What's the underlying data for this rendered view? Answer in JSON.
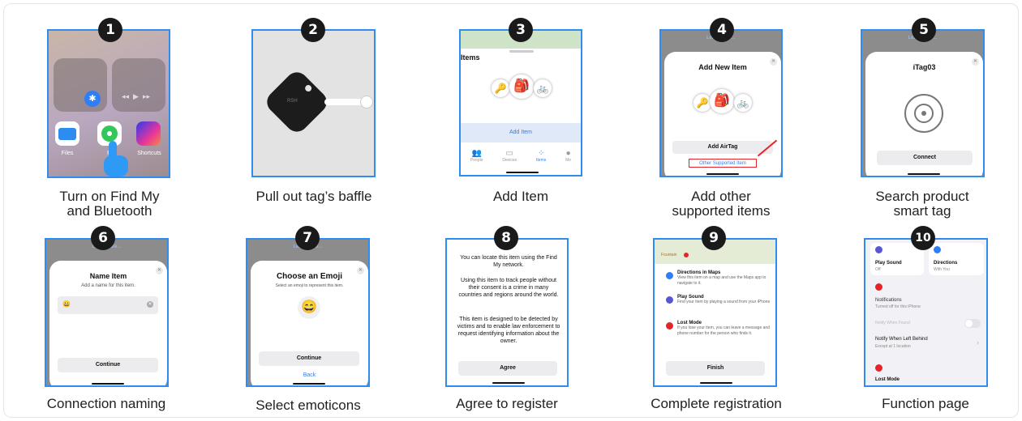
{
  "steps": [
    {
      "num": "1",
      "caption_line1": "Turn on Find My",
      "caption_line2": "and Bluetooth"
    },
    {
      "num": "2",
      "caption_line1": "Pull out tag’s baffle",
      "caption_line2": ""
    },
    {
      "num": "3",
      "caption_line1": "Add Item",
      "caption_line2": ""
    },
    {
      "num": "4",
      "caption_line1": "Add other",
      "caption_line2": "supported items"
    },
    {
      "num": "5",
      "caption_line1": "Search product",
      "caption_line2": "smart tag"
    },
    {
      "num": "6",
      "caption_line1": "Connection naming",
      "caption_line2": ""
    },
    {
      "num": "7",
      "caption_line1": "Select emoticons",
      "caption_line2": ""
    },
    {
      "num": "8",
      "caption_line1": "Agree to register",
      "caption_line2": ""
    },
    {
      "num": "9",
      "caption_line1": "Complete registration",
      "caption_line2": ""
    },
    {
      "num": "10",
      "caption_line1": "Function page",
      "caption_line2": ""
    }
  ],
  "s1": {
    "files": "Files",
    "findmy": "Fi",
    "shortcuts": "Shortcuts"
  },
  "s2": {
    "tag_text": "RSH"
  },
  "s3": {
    "title": "Items",
    "add_item": "Add Item",
    "tabs": [
      "People",
      "Devices",
      "Items",
      "Me"
    ]
  },
  "s4": {
    "learn": "Learn More...",
    "title": "Add New Item",
    "add_airtag": "Add AirTag",
    "other": "Other Supported Item"
  },
  "s5": {
    "learn": "Learn More...",
    "title": "iTag03",
    "connect": "Connect"
  },
  "s6": {
    "learn": "Learn More...",
    "title": "Name Item",
    "subtitle": "Add a name for this item.",
    "emoji": "😀",
    "continue": "Continue"
  },
  "s7": {
    "learn": "Learn More...",
    "title": "Choose an Emoji",
    "subtitle": "Select an emoji to represent this item.",
    "emoji": "😄",
    "continue": "Continue",
    "back": "Back"
  },
  "s8": {
    "p1": "You can locate this item using the Find My network.",
    "p2": "Using this item to track people without their consent is a crime in many countries and regions around the world.",
    "p3": "This item is designed to be detected by victims and to enable law enforcement to request identifying information about the owner.",
    "agree": "Agree"
  },
  "s9": {
    "map_label": "Fountain",
    "items": [
      {
        "title": "Directions in Maps",
        "desc": "View this item on a map and use the Maps app to navigate to it."
      },
      {
        "title": "Play Sound",
        "desc": "Find your item by playing a sound from your iPhone"
      },
      {
        "title": "Lost Mode",
        "desc": "If you lose your item, you can leave a message and phone number for the person who finds it."
      }
    ],
    "finish": "Finish"
  },
  "s10": {
    "play_sound": "Play Sound",
    "play_sub": "Off",
    "directions": "Directions",
    "directions_sub": "With You",
    "notifications": "Notifications",
    "notifications_sub": "Turned off for this iPhone",
    "notify_found": "Notify When Found",
    "notify_left": "Notify When Left Behind",
    "notify_left_sub": "Except at 1 location",
    "lost_mode": "Lost Mode"
  },
  "colors": {
    "accent": "#2f8cf0",
    "badge": "#1a1a1a",
    "alert": "#e5242a"
  }
}
